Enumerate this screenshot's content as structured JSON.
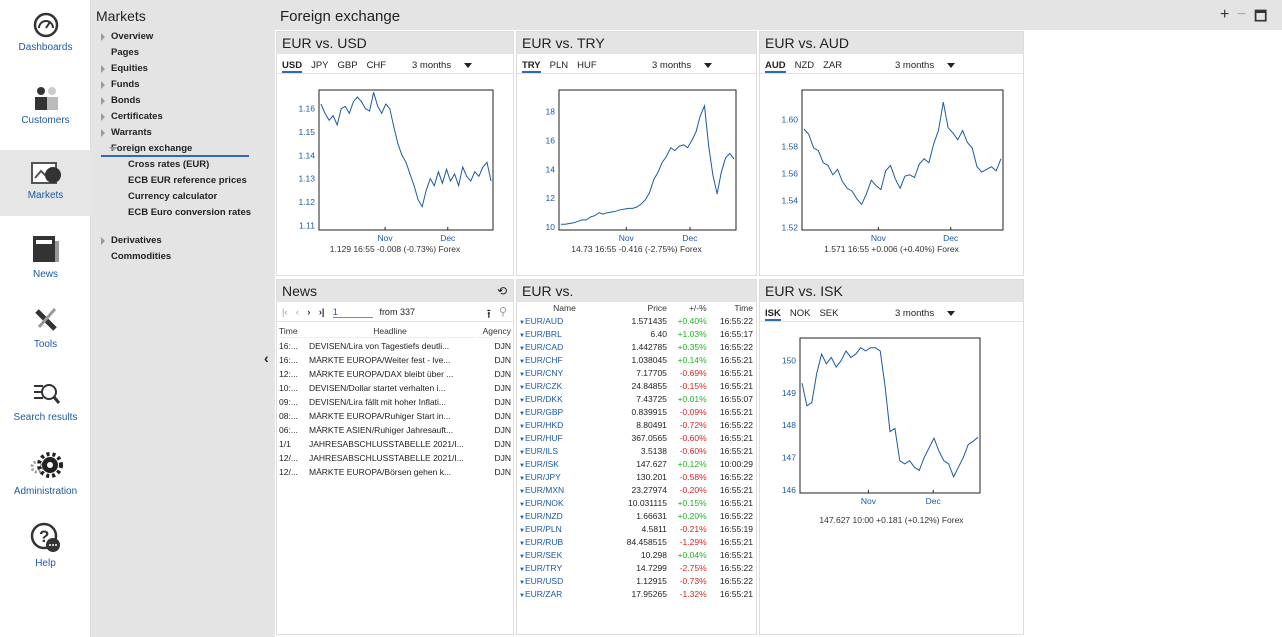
{
  "rail": {
    "items": [
      {
        "label": "Dashboards",
        "icon": "dashboard-gauge-icon"
      },
      {
        "label": "Customers",
        "icon": "customers-icon"
      },
      {
        "label": "Markets",
        "icon": "markets-pie-chart-icon",
        "active": true
      },
      {
        "label": "News",
        "icon": "news-icon"
      },
      {
        "label": "Tools",
        "icon": "tools-icon"
      },
      {
        "label": "Search results",
        "icon": "search-results-icon"
      },
      {
        "label": "Administration",
        "icon": "gear-icon"
      },
      {
        "label": "Help",
        "icon": "help-icon"
      }
    ]
  },
  "nav": {
    "title": "Markets",
    "items": [
      {
        "label": "Overview",
        "type": "arr"
      },
      {
        "label": "Pages",
        "type": "plain"
      },
      {
        "label": "Equities",
        "type": "arr"
      },
      {
        "label": "Funds",
        "type": "arr"
      },
      {
        "label": "Bonds",
        "type": "arr"
      },
      {
        "label": "Certificates",
        "type": "arr"
      },
      {
        "label": "Warrants",
        "type": "arr"
      },
      {
        "label": "Foreign exchange",
        "type": "open"
      },
      {
        "label": "Cross rates (EUR)",
        "type": "sub"
      },
      {
        "label": "ECB EUR reference prices",
        "type": "sub"
      },
      {
        "label": "Currency calculator",
        "type": "sub"
      },
      {
        "label": "ECB Euro conversion rates",
        "type": "sub"
      }
    ],
    "items2": [
      {
        "label": "Derivatives",
        "type": "arr"
      },
      {
        "label": "Commodities",
        "type": "plain"
      }
    ]
  },
  "page": {
    "title": "Foreign exchange",
    "win_plus": "+",
    "win_minus": "−",
    "win_max": "🗖"
  },
  "charts_panels": [
    {
      "title": "EUR vs. USD",
      "tabs": [
        "USD",
        "JPY",
        "GBP",
        "CHF"
      ],
      "range": "3 months",
      "footer": "1.129 16:55 -0.008 (-0.73%) Forex"
    },
    {
      "title": "EUR vs. TRY",
      "tabs": [
        "TRY",
        "PLN",
        "HUF"
      ],
      "range": "3 months",
      "footer": "14.73 16:55 -0.416 (-2.75%) Forex"
    },
    {
      "title": "EUR vs. AUD",
      "tabs": [
        "AUD",
        "NZD",
        "ZAR"
      ],
      "range": "3 months",
      "footer": "1.571 16:55 +0.006 (+0.40%) Forex"
    },
    {
      "title": "EUR vs. ISK",
      "tabs": [
        "ISK",
        "NOK",
        "SEK"
      ],
      "range": "3 months",
      "footer": "147.627 10:00 +0.181 (+0.12%) Forex"
    }
  ],
  "chart_data": [
    {
      "type": "line",
      "title": "EUR vs. USD",
      "categories": [
        "Nov",
        "Dec"
      ],
      "yticks": [
        "1.11",
        "1.12",
        "1.13",
        "1.14",
        "1.15",
        "1.16"
      ],
      "ylim": [
        1.108,
        1.168
      ],
      "values": [
        1.162,
        1.158,
        1.155,
        1.157,
        1.153,
        1.16,
        1.161,
        1.158,
        1.163,
        1.165,
        1.163,
        1.16,
        1.159,
        1.167,
        1.161,
        1.158,
        1.162,
        1.16,
        1.152,
        1.145,
        1.14,
        1.137,
        1.132,
        1.127,
        1.121,
        1.118,
        1.125,
        1.13,
        1.127,
        1.133,
        1.128,
        1.134,
        1.129,
        1.132,
        1.127,
        1.135,
        1.131,
        1.129,
        1.133,
        1.131,
        1.135,
        1.137,
        1.129
      ]
    },
    {
      "type": "line",
      "title": "EUR vs. TRY",
      "categories": [
        "Nov",
        "Dec"
      ],
      "yticks": [
        "10",
        "12",
        "14",
        "16",
        "18"
      ],
      "ylim": [
        9.8,
        19.5
      ],
      "values": [
        10.2,
        10.2,
        10.25,
        10.3,
        10.4,
        10.5,
        10.5,
        10.7,
        10.8,
        11.0,
        10.9,
        11.0,
        11.05,
        11.1,
        11.2,
        11.25,
        11.3,
        11.3,
        11.4,
        11.6,
        11.9,
        12.4,
        13.3,
        13.8,
        14.5,
        14.9,
        15.5,
        15.3,
        15.6,
        15.7,
        15.5,
        16.0,
        16.6,
        17.7,
        18.4,
        15.6,
        13.6,
        12.3,
        13.8,
        14.8,
        15.1,
        14.73
      ]
    },
    {
      "type": "line",
      "title": "EUR vs. AUD",
      "categories": [
        "Nov",
        "Dec"
      ],
      "yticks": [
        "1.52",
        "1.54",
        "1.56",
        "1.58",
        "1.60"
      ],
      "ylim": [
        1.518,
        1.622
      ],
      "values": [
        1.593,
        1.589,
        1.579,
        1.577,
        1.568,
        1.566,
        1.559,
        1.563,
        1.554,
        1.549,
        1.547,
        1.541,
        1.537,
        1.545,
        1.555,
        1.551,
        1.548,
        1.562,
        1.566,
        1.556,
        1.549,
        1.558,
        1.559,
        1.557,
        1.567,
        1.571,
        1.568,
        1.582,
        1.592,
        1.613,
        1.594,
        1.59,
        1.585,
        1.592,
        1.583,
        1.579,
        1.565,
        1.561,
        1.563,
        1.565,
        1.562,
        1.571
      ]
    },
    {
      "type": "line",
      "title": "EUR vs. ISK",
      "categories": [
        "Nov",
        "Dec"
      ],
      "yticks": [
        "146",
        "147",
        "148",
        "149",
        "150"
      ],
      "ylim": [
        145.9,
        150.7
      ],
      "values": [
        149.3,
        148.6,
        148.7,
        149.6,
        150.2,
        149.9,
        150.1,
        149.8,
        150.0,
        150.3,
        150.1,
        150.2,
        150.4,
        150.3,
        150.4,
        150.4,
        150.3,
        149.2,
        147.8,
        147.9,
        146.9,
        146.8,
        146.9,
        146.7,
        146.6,
        147.0,
        147.3,
        147.6,
        147.2,
        146.9,
        146.8,
        146.4,
        146.7,
        147.0,
        147.4,
        147.5,
        147.627
      ]
    }
  ],
  "news": {
    "title": "News",
    "pager_input": "1",
    "pager_text": "from 337",
    "cols": [
      "Time",
      "Headline",
      "Agency"
    ],
    "rows": [
      [
        "16:...",
        "DEVISEN/Lira von Tagestiefs deutli...",
        "DJN"
      ],
      [
        "16:...",
        "MÄRKTE EUROPA/Weiter fest - lve...",
        "DJN"
      ],
      [
        "12:...",
        "MÄRKTE EUROPA/DAX bleibt über ...",
        "DJN"
      ],
      [
        "10:...",
        "DEVISEN/Dollar startet verhalten i...",
        "DJN"
      ],
      [
        "09:...",
        "DEVISEN/Lira fällt mit hoher Inflati...",
        "DJN"
      ],
      [
        "08:...",
        "MÄRKTE EUROPA/Ruhiger Start in...",
        "DJN"
      ],
      [
        "06:...",
        "MÄRKTE ASIEN/Ruhiger Jahresauft...",
        "DJN"
      ],
      [
        "1/1",
        "JAHRESABSCHLUSSTABELLE 2021/I...",
        "DJN"
      ],
      [
        "12/...",
        "JAHRESABSCHLUSSTABELLE 2021/I...",
        "DJN"
      ],
      [
        "12/...",
        "MÄRKTE EUROPA/Börsen gehen k...",
        "DJN"
      ]
    ]
  },
  "rates": {
    "title": "EUR vs.",
    "cols": [
      "Name",
      "Price",
      "+/-%",
      "Time"
    ],
    "rows": [
      [
        "EUR/AUD",
        "1.571435",
        "+0.40%",
        "16:55:22"
      ],
      [
        "EUR/BRL",
        "6.40",
        "+1.03%",
        "16:55:17"
      ],
      [
        "EUR/CAD",
        "1.442785",
        "+0.35%",
        "16:55:22"
      ],
      [
        "EUR/CHF",
        "1.038045",
        "+0.14%",
        "16:55:21"
      ],
      [
        "EUR/CNY",
        "7.17705",
        "-0.69%",
        "16:55:21"
      ],
      [
        "EUR/CZK",
        "24.84855",
        "-0.15%",
        "16:55:21"
      ],
      [
        "EUR/DKK",
        "7.43725",
        "+0.01%",
        "16:55:07"
      ],
      [
        "EUR/GBP",
        "0.839915",
        "-0.09%",
        "16:55:21"
      ],
      [
        "EUR/HKD",
        "8.80491",
        "-0.72%",
        "16:55:22"
      ],
      [
        "EUR/HUF",
        "367.0565",
        "-0.60%",
        "16:55:21"
      ],
      [
        "EUR/ILS",
        "3.5138",
        "-0.60%",
        "16:55:21"
      ],
      [
        "EUR/ISK",
        "147.627",
        "+0.12%",
        "10:00:29"
      ],
      [
        "EUR/JPY",
        "130.201",
        "-0.58%",
        "16:55:22"
      ],
      [
        "EUR/MXN",
        "23.27974",
        "-0.20%",
        "16:55:21"
      ],
      [
        "EUR/NOK",
        "10.031115",
        "+0.15%",
        "16:55:21"
      ],
      [
        "EUR/NZD",
        "1.66631",
        "+0.20%",
        "16:55:22"
      ],
      [
        "EUR/PLN",
        "4.5811",
        "-0.21%",
        "16:55:19"
      ],
      [
        "EUR/RUB",
        "84.458515",
        "-1.29%",
        "16:55:21"
      ],
      [
        "EUR/SEK",
        "10.298",
        "+0.04%",
        "16:55:21"
      ],
      [
        "EUR/TRY",
        "14.7299",
        "-2.75%",
        "16:55:22"
      ],
      [
        "EUR/USD",
        "1.12915",
        "-0.73%",
        "16:55:22"
      ],
      [
        "EUR/ZAR",
        "17.95265",
        "-1.32%",
        "16:55:21"
      ]
    ]
  },
  "colors": {
    "line": "#1b5aa6",
    "positive": "#1db51d",
    "negative": "#dd2222",
    "accent": "#2a6ab8"
  }
}
